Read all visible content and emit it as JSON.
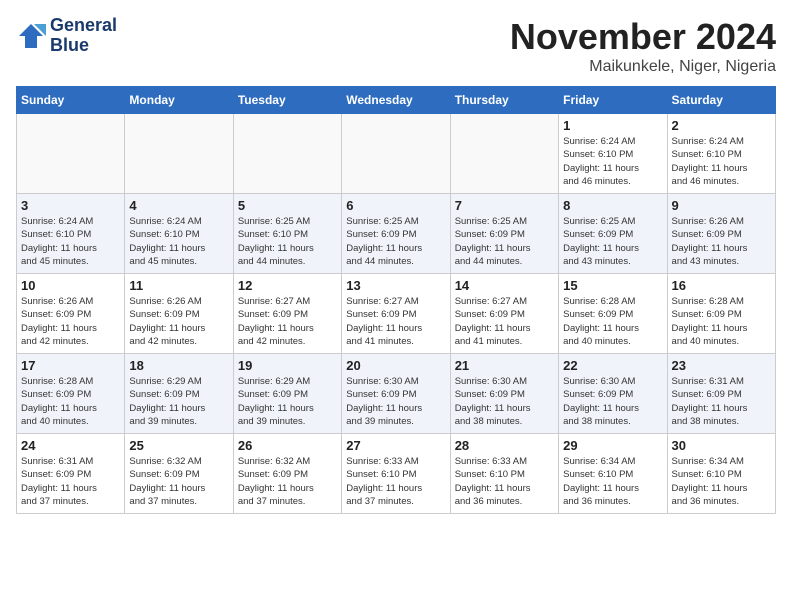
{
  "logo": {
    "line1": "General",
    "line2": "Blue"
  },
  "title": "November 2024",
  "location": "Maikunkele, Niger, Nigeria",
  "days_of_week": [
    "Sunday",
    "Monday",
    "Tuesday",
    "Wednesday",
    "Thursday",
    "Friday",
    "Saturday"
  ],
  "weeks": [
    [
      {
        "day": "",
        "info": ""
      },
      {
        "day": "",
        "info": ""
      },
      {
        "day": "",
        "info": ""
      },
      {
        "day": "",
        "info": ""
      },
      {
        "day": "",
        "info": ""
      },
      {
        "day": "1",
        "info": "Sunrise: 6:24 AM\nSunset: 6:10 PM\nDaylight: 11 hours\nand 46 minutes."
      },
      {
        "day": "2",
        "info": "Sunrise: 6:24 AM\nSunset: 6:10 PM\nDaylight: 11 hours\nand 46 minutes."
      }
    ],
    [
      {
        "day": "3",
        "info": "Sunrise: 6:24 AM\nSunset: 6:10 PM\nDaylight: 11 hours\nand 45 minutes."
      },
      {
        "day": "4",
        "info": "Sunrise: 6:24 AM\nSunset: 6:10 PM\nDaylight: 11 hours\nand 45 minutes."
      },
      {
        "day": "5",
        "info": "Sunrise: 6:25 AM\nSunset: 6:10 PM\nDaylight: 11 hours\nand 44 minutes."
      },
      {
        "day": "6",
        "info": "Sunrise: 6:25 AM\nSunset: 6:09 PM\nDaylight: 11 hours\nand 44 minutes."
      },
      {
        "day": "7",
        "info": "Sunrise: 6:25 AM\nSunset: 6:09 PM\nDaylight: 11 hours\nand 44 minutes."
      },
      {
        "day": "8",
        "info": "Sunrise: 6:25 AM\nSunset: 6:09 PM\nDaylight: 11 hours\nand 43 minutes."
      },
      {
        "day": "9",
        "info": "Sunrise: 6:26 AM\nSunset: 6:09 PM\nDaylight: 11 hours\nand 43 minutes."
      }
    ],
    [
      {
        "day": "10",
        "info": "Sunrise: 6:26 AM\nSunset: 6:09 PM\nDaylight: 11 hours\nand 42 minutes."
      },
      {
        "day": "11",
        "info": "Sunrise: 6:26 AM\nSunset: 6:09 PM\nDaylight: 11 hours\nand 42 minutes."
      },
      {
        "day": "12",
        "info": "Sunrise: 6:27 AM\nSunset: 6:09 PM\nDaylight: 11 hours\nand 42 minutes."
      },
      {
        "day": "13",
        "info": "Sunrise: 6:27 AM\nSunset: 6:09 PM\nDaylight: 11 hours\nand 41 minutes."
      },
      {
        "day": "14",
        "info": "Sunrise: 6:27 AM\nSunset: 6:09 PM\nDaylight: 11 hours\nand 41 minutes."
      },
      {
        "day": "15",
        "info": "Sunrise: 6:28 AM\nSunset: 6:09 PM\nDaylight: 11 hours\nand 40 minutes."
      },
      {
        "day": "16",
        "info": "Sunrise: 6:28 AM\nSunset: 6:09 PM\nDaylight: 11 hours\nand 40 minutes."
      }
    ],
    [
      {
        "day": "17",
        "info": "Sunrise: 6:28 AM\nSunset: 6:09 PM\nDaylight: 11 hours\nand 40 minutes."
      },
      {
        "day": "18",
        "info": "Sunrise: 6:29 AM\nSunset: 6:09 PM\nDaylight: 11 hours\nand 39 minutes."
      },
      {
        "day": "19",
        "info": "Sunrise: 6:29 AM\nSunset: 6:09 PM\nDaylight: 11 hours\nand 39 minutes."
      },
      {
        "day": "20",
        "info": "Sunrise: 6:30 AM\nSunset: 6:09 PM\nDaylight: 11 hours\nand 39 minutes."
      },
      {
        "day": "21",
        "info": "Sunrise: 6:30 AM\nSunset: 6:09 PM\nDaylight: 11 hours\nand 38 minutes."
      },
      {
        "day": "22",
        "info": "Sunrise: 6:30 AM\nSunset: 6:09 PM\nDaylight: 11 hours\nand 38 minutes."
      },
      {
        "day": "23",
        "info": "Sunrise: 6:31 AM\nSunset: 6:09 PM\nDaylight: 11 hours\nand 38 minutes."
      }
    ],
    [
      {
        "day": "24",
        "info": "Sunrise: 6:31 AM\nSunset: 6:09 PM\nDaylight: 11 hours\nand 37 minutes."
      },
      {
        "day": "25",
        "info": "Sunrise: 6:32 AM\nSunset: 6:09 PM\nDaylight: 11 hours\nand 37 minutes."
      },
      {
        "day": "26",
        "info": "Sunrise: 6:32 AM\nSunset: 6:09 PM\nDaylight: 11 hours\nand 37 minutes."
      },
      {
        "day": "27",
        "info": "Sunrise: 6:33 AM\nSunset: 6:10 PM\nDaylight: 11 hours\nand 37 minutes."
      },
      {
        "day": "28",
        "info": "Sunrise: 6:33 AM\nSunset: 6:10 PM\nDaylight: 11 hours\nand 36 minutes."
      },
      {
        "day": "29",
        "info": "Sunrise: 6:34 AM\nSunset: 6:10 PM\nDaylight: 11 hours\nand 36 minutes."
      },
      {
        "day": "30",
        "info": "Sunrise: 6:34 AM\nSunset: 6:10 PM\nDaylight: 11 hours\nand 36 minutes."
      }
    ]
  ]
}
